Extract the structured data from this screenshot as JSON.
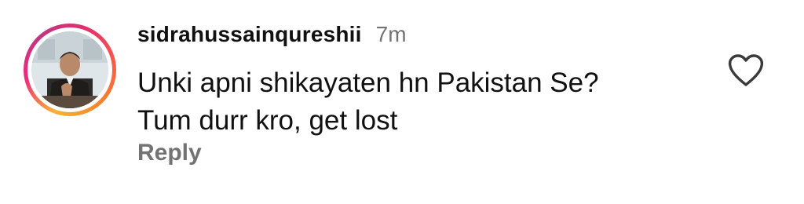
{
  "comment": {
    "username": "sidrahussainqureshii",
    "timestamp": "7m",
    "text_lines": [
      "Unki apni shikayaten hn Pakistan Se?",
      "Tum durr kro, get lost"
    ],
    "reply_label": "Reply",
    "avatar_ring_colors": [
      "#f9b233",
      "#ee2a7b",
      "#c13584",
      "#f58529"
    ],
    "like_icon": "heart-outline-icon",
    "secondary_text_color": "#737373"
  }
}
